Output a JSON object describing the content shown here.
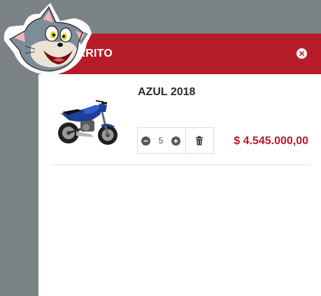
{
  "cart": {
    "title": "CARRITO",
    "close_icon": "close-circle-icon",
    "items": [
      {
        "name": "AZUL 2018",
        "quantity": "5",
        "price": "$ 4.545.000,00",
        "image": "blue-motorcycle",
        "minus_icon": "minus-circle-icon",
        "plus_icon": "plus-circle-icon",
        "delete_icon": "trash-icon"
      }
    ]
  },
  "theme": {
    "accent": "#b71c2a",
    "backdrop": "#7b8385"
  },
  "mascot": {
    "image": "cartoon-cat-logo"
  }
}
